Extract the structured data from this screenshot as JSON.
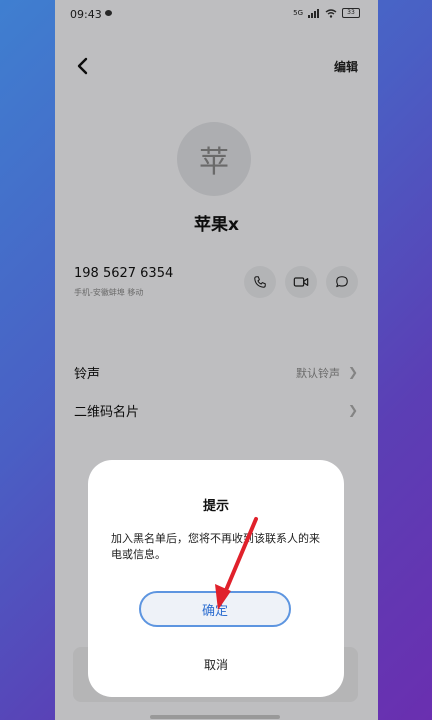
{
  "status_bar": {
    "time": "09:43",
    "network": "5G",
    "battery": "33"
  },
  "header": {
    "edit_label": "编辑"
  },
  "contact": {
    "avatar_char": "苹",
    "name": "苹果x",
    "phone": "198 5627 6354",
    "phone_label": "手机-安徽蚌埠 移动"
  },
  "settings": [
    {
      "label": "铃声",
      "value": "默认铃声"
    },
    {
      "label": "二维码名片",
      "value": ""
    }
  ],
  "dialog": {
    "title": "提示",
    "message": "加入黑名单后，您将不再收到该联系人的来电或信息。",
    "confirm_label": "确定",
    "cancel_label": "取消"
  },
  "colors": {
    "accent": "#2f6fd0",
    "annotation_arrow": "#e0212b"
  }
}
